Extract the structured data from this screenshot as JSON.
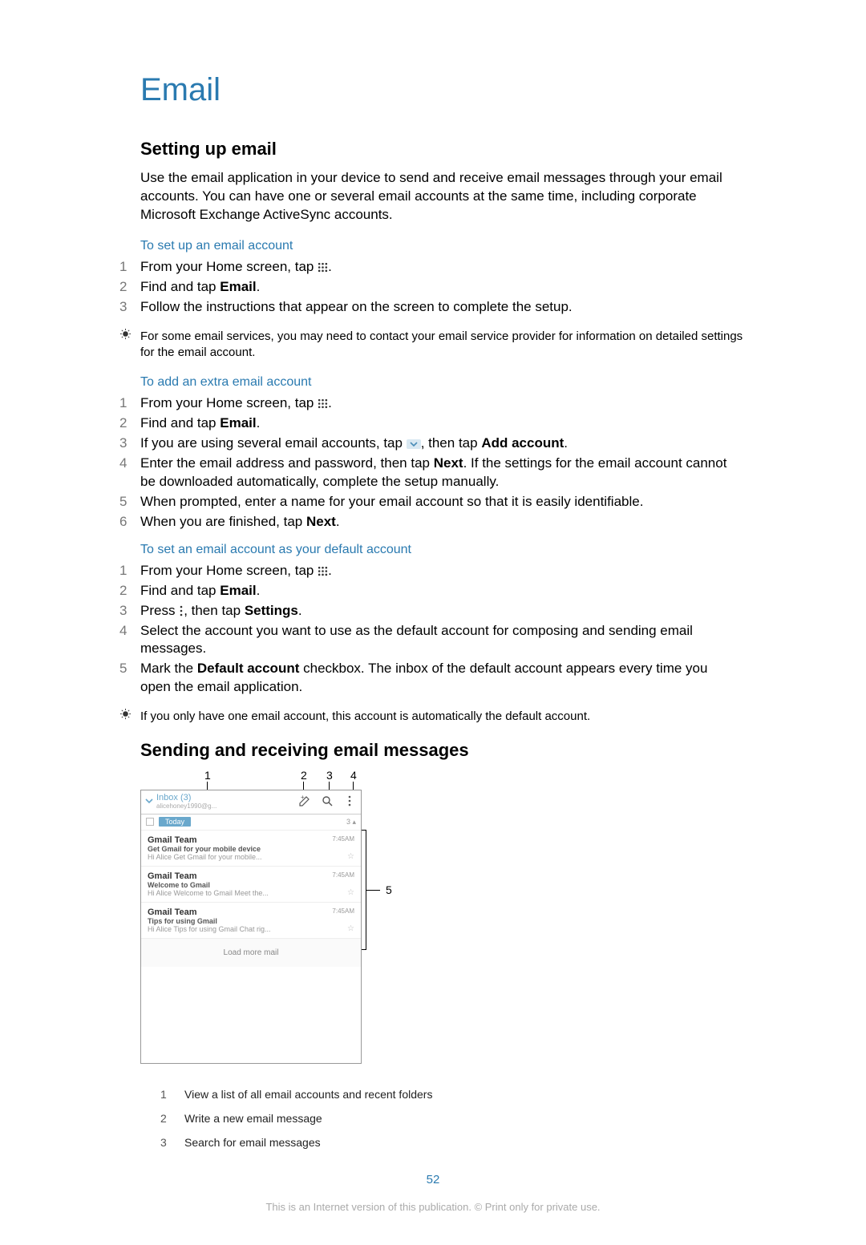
{
  "page": {
    "title": "Email",
    "number": "52",
    "disclaimer": "This is an Internet version of this publication. © Print only for private use."
  },
  "sections": {
    "setup": {
      "heading": "Setting up email",
      "intro": "Use the email application in your device to send and receive email messages through your email accounts. You can have one or several email accounts at the same time, including corporate Microsoft Exchange ActiveSync accounts.",
      "sub1_title": "To set up an email account",
      "sub1_steps": [
        {
          "num": "1",
          "pre": "From your Home screen, tap ",
          "post": "."
        },
        {
          "num": "2",
          "pre": "Find and tap ",
          "bold": "Email",
          "post": "."
        },
        {
          "num": "3",
          "text": "Follow the instructions that appear on the screen to complete the setup."
        }
      ],
      "sub1_tip": "For some email services, you may need to contact your email service provider for information on detailed settings for the email account.",
      "sub2_title": "To add an extra email account",
      "sub2_steps": [
        {
          "num": "1",
          "pre": "From your Home screen, tap ",
          "post": "."
        },
        {
          "num": "2",
          "pre": "Find and tap ",
          "bold": "Email",
          "post": "."
        },
        {
          "num": "3",
          "pre": "If you are using several email accounts, tap ",
          "mid": ", then tap ",
          "bold2": "Add account",
          "post": "."
        },
        {
          "num": "4",
          "pre": "Enter the email address and password, then tap ",
          "bold": "Next",
          "post": ". If the settings for the email account cannot be downloaded automatically, complete the setup manually."
        },
        {
          "num": "5",
          "text": "When prompted, enter a name for your email account so that it is easily identifiable."
        },
        {
          "num": "6",
          "pre": "When you are finished, tap ",
          "bold": "Next",
          "post": "."
        }
      ],
      "sub3_title": "To set an email account as your default account",
      "sub3_steps": [
        {
          "num": "1",
          "pre": "From your Home screen, tap ",
          "post": "."
        },
        {
          "num": "2",
          "pre": "Find and tap ",
          "bold": "Email",
          "post": "."
        },
        {
          "num": "3",
          "pre": "Press ",
          "mid": ", then tap ",
          "bold2": "Settings",
          "post": "."
        },
        {
          "num": "4",
          "text": "Select the account you want to use as the default account for composing and sending email messages."
        },
        {
          "num": "5",
          "pre": "Mark the ",
          "bold": "Default account",
          "post": " checkbox. The inbox of the default account appears every time you open the email application."
        }
      ],
      "sub3_tip": "If you only have one email account, this account is automatically the default account."
    },
    "sending": {
      "heading": "Sending and receiving email messages",
      "callouts": {
        "c1": "1",
        "c2": "2",
        "c3": "3",
        "c4": "4",
        "c5": "5"
      },
      "phone": {
        "inbox_label": "Inbox (3)",
        "account_sub": "alicehoney1990@g...",
        "today": "Today",
        "today_count": "3",
        "messages": [
          {
            "from": "Gmail Team",
            "subject": "Get Gmail for your mobile device",
            "preview": "Hi Alice Get Gmail for your mobile...",
            "time": "7:45AM"
          },
          {
            "from": "Gmail Team",
            "subject": "Welcome to Gmail",
            "preview": "Hi Alice Welcome to Gmail Meet the...",
            "time": "7:45AM"
          },
          {
            "from": "Gmail Team",
            "subject": "Tips for using Gmail",
            "preview": "Hi Alice Tips for using Gmail Chat rig...",
            "time": "7:45AM"
          }
        ],
        "load_more": "Load more mail"
      },
      "legend": [
        {
          "n": "1",
          "t": "View a list of all email accounts and recent folders"
        },
        {
          "n": "2",
          "t": "Write a new email message"
        },
        {
          "n": "3",
          "t": "Search for email messages"
        }
      ]
    }
  }
}
